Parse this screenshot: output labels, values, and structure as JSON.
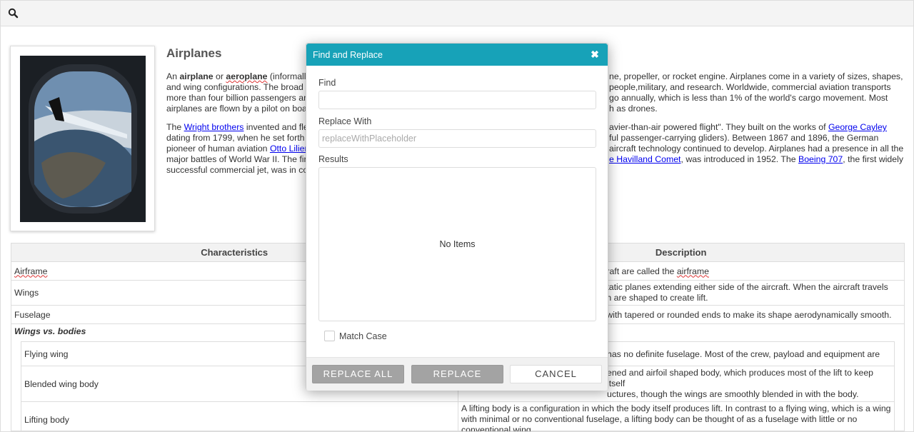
{
  "toolbar": {
    "search_icon": "search-icon"
  },
  "document": {
    "title": "Airplanes",
    "p1": {
      "l1a": "An ",
      "l1b": "airplane",
      "l1c": " or ",
      "l1d": "aeroplane",
      "l1e": " (informally",
      "l1f": "ne, propeller, or rocket engine. Airplanes come in a variety of sizes, shapes,",
      "l2a": "and wing configurations. The broad s",
      "l2b": "people,military, and research. Worldwide, commercial aviation transports",
      "l3a": "more than four billion passengers an",
      "l3b": "go annually, which is less than 1% of the world's cargo movement. Most",
      "l4a": "airplanes are flown by a pilot on boa",
      "l4b": "h as drones."
    },
    "p2": {
      "l1a": "The ",
      "l1link": "Wright brothers",
      "l1b": " invented and fle",
      "l1c": "avier-than-air powered flight\". They built on the works of ",
      "l1link2": "George Cayley",
      "l2a": "dating from 1799, when he set forth t",
      "l2b": "ful passenger-carrying gliders). Between 1867 and 1896, the German",
      "l3a": "pioneer of human aviation ",
      "l3link": "Otto Lilien",
      "l3b": "aircraft technology continued to develop. Airplanes had a presence in all the",
      "l4a": "major battles of World War II. The firs",
      "l4link": "e Havilland Comet",
      "l4b": ", was introduced in 1952. The ",
      "l4link2": "Boeing 707",
      "l4c": ", the first widely",
      "l5a": "successful commercial jet, was in co"
    },
    "table": {
      "headers": [
        "Characteristics",
        "Description"
      ],
      "rows": [
        {
          "name": "Airframe",
          "desc_a": "raft are called the ",
          "desc_b": "airframe"
        },
        {
          "name": "Wings",
          "desc_1": "tatic planes extending either side of the aircraft. When the aircraft travels",
          "desc_2": "h are shaped to create lift."
        },
        {
          "name": "Fuselage",
          "desc_1": "with tapered or rounded ends to make its shape aerodynamically smooth."
        }
      ],
      "section": "Wings vs. bodies",
      "sub_rows": [
        {
          "name": "Flying wing",
          "desc_1": "has no definite fuselage. Most of the crew, payload and equipment are"
        },
        {
          "name": "Blended wing body",
          "desc_1": "ened and airfoil shaped body, which produces most of the lift to keep itself",
          "desc_2": "uctures, though the wings are smoothly blended in with the body."
        },
        {
          "name": "Lifting body",
          "desc_1": "A lifting body is a configuration in which the body itself produces lift. In contrast to a flying wing, which is a wing",
          "desc_2": "with minimal or no conventional fuselage, a lifting body can be thought of as a fuselage with little or no",
          "desc_3": "conventional wing."
        }
      ]
    }
  },
  "dialog": {
    "title": "Find and Replace",
    "close_icon": "close-icon",
    "find_label": "Find",
    "find_value": "",
    "replace_label": "Replace With",
    "replace_placeholder": "replaceWithPlaceholder",
    "results_label": "Results",
    "results_empty": "No Items",
    "match_case_label": "Match Case",
    "match_case_checked": false,
    "buttons": {
      "replace_all": "REPLACE ALL",
      "replace": "REPLACE",
      "cancel": "CANCEL"
    }
  },
  "colors": {
    "header": "#17a2b8",
    "button_grey": "#a3a3a3",
    "link": "#0000ee"
  }
}
